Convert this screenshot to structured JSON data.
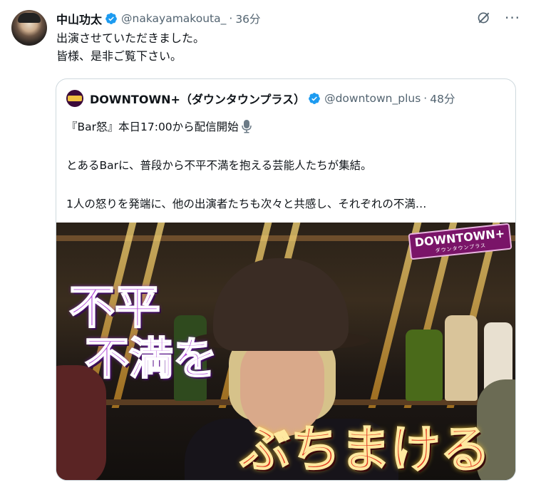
{
  "author": {
    "display_name": "中山功太",
    "handle": "@nakayamakouta_",
    "separator": "·",
    "time": "36分",
    "avatar_icon": "user-avatar",
    "verified_icon": "verified-badge-icon"
  },
  "actions": {
    "grok_icon": "grok-icon",
    "more_icon": "more-options-icon"
  },
  "tweet_text": "出演させていただきました。\n皆様、是非ご覧下さい。",
  "quote": {
    "display_name": "DOWNTOWN+（ダウンタウンプラス）",
    "handle": "@downtown_plus",
    "separator": "·",
    "time": "48分",
    "line1": "『Bar怒』本日17:00から配信開始",
    "line1_icon": "microphone-icon",
    "line2": "とあるBarに、普段から不平不満を抱える芸能人たちが集結。",
    "line3": "1人の怒りを発端に、他の出演者たちも次々と共感し、それぞれの不満…",
    "media": {
      "caption_left_1": "不平",
      "caption_left_2": "不満を",
      "caption_bottom": "ぶちまける",
      "logo": "DOWNTOWN+",
      "logo_sub": "ダウンタウンプラス"
    }
  },
  "colors": {
    "text_primary": "#0f1419",
    "text_secondary": "#536471",
    "verified": "#1d9bf0",
    "border": "#cfd9de"
  }
}
